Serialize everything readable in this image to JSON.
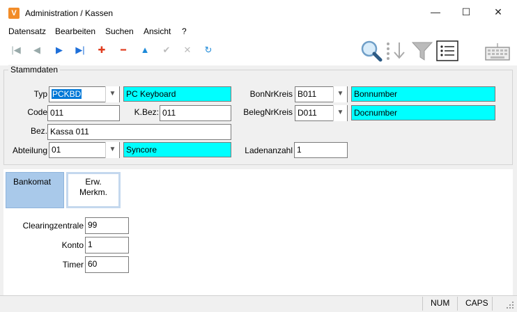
{
  "window": {
    "icon_letter": "V",
    "title": "Administration / Kassen",
    "minimize": "—",
    "maximize": "☐",
    "close": "✕"
  },
  "menu": [
    "Datensatz",
    "Bearbeiten",
    "Suchen",
    "Ansicht",
    "?"
  ],
  "toolbar": {
    "first": "|◀",
    "prev": "◀",
    "next": "▶",
    "last": "▶|",
    "add": "✚",
    "delete": "━",
    "up": "▲",
    "confirm": "✔",
    "cancel": "✕",
    "refresh": "↻"
  },
  "stammdaten": {
    "title": "Stammdaten",
    "typ_label": "Typ",
    "typ_value": "PCKBD",
    "typ_desc": "PC Keyboard",
    "code_label": "Code",
    "code_value": "011",
    "kbez_label": "K.Bez:",
    "kbez_value": "011",
    "bez_label": "Bez.",
    "bez_value": "Kassa 011",
    "abteilung_label": "Abteilung",
    "abteilung_value": "01",
    "abteilung_desc": "Syncore",
    "bonnrkreis_label": "BonNrKreis",
    "bonnrkreis_value": "B011",
    "bonnrkreis_desc": "Bonnumber",
    "belegnrkreis_label": "BelegNrKreis",
    "belegnrkreis_value": "D011",
    "belegnrkreis_desc": "Docnumber",
    "ladenanzahl_label": "Ladenanzahl",
    "ladenanzahl_value": "1"
  },
  "tabs": {
    "bankomat": "Bankomat",
    "erw_line1": "Erw.",
    "erw_line2": "Merkm."
  },
  "bankomat": {
    "clearing_label": "Clearingzentrale",
    "clearing_value": "99",
    "konto_label": "Konto",
    "konto_value": "1",
    "timer_label": "Timer",
    "timer_value": "60"
  },
  "status": {
    "num": "NUM",
    "caps": "CAPS"
  },
  "colors": {
    "accent_cyan": "#00ffff",
    "selection_blue": "#0078d7",
    "tab_active": "#a9c9ea",
    "nav_blue": "#1e6fd9",
    "add_red": "#e03c1e"
  }
}
